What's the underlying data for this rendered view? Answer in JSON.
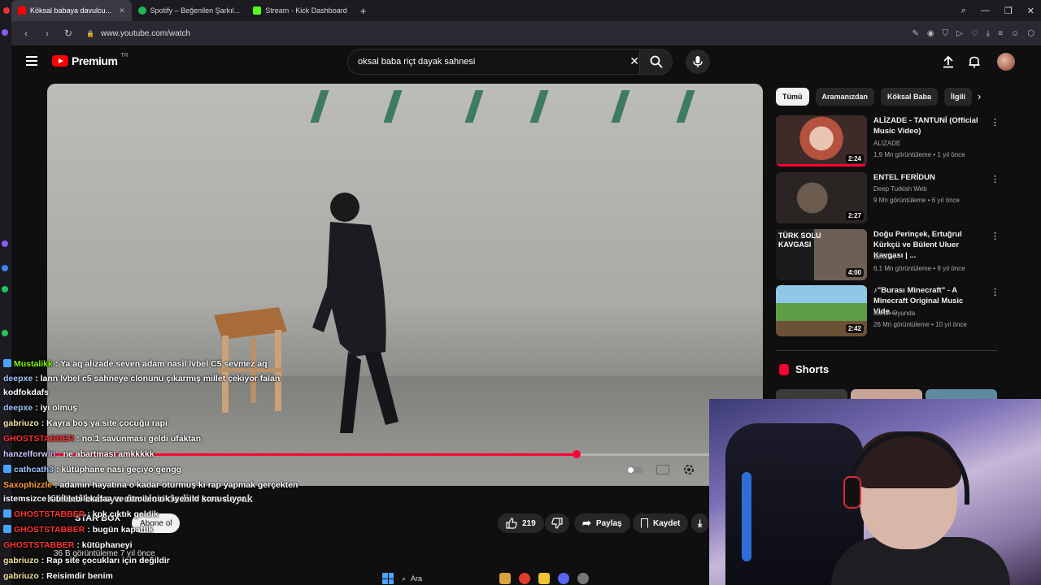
{
  "browser": {
    "tabs": [
      {
        "label": "Köksal babaya davulcu...",
        "color": "#ff0000",
        "active": true
      },
      {
        "label": "Spotify – Beğenilen Şarkıl...",
        "color": "#1db954",
        "active": false
      },
      {
        "label": "Stream - Kick Dashboard",
        "color": "#53fc18",
        "active": false
      }
    ],
    "new_tab": "+",
    "url": "www.youtube.com/watch"
  },
  "youtube": {
    "logo": "Premium",
    "country": "TR",
    "search_value": "oksal baba riçt dayak sahnesi",
    "clear": "✕"
  },
  "video": {
    "progress_fraction": 0.74,
    "title": "Köksal babaya davulcu dedim sıra dayak",
    "channel": "STAR BOX",
    "subscribe": "Abone ol",
    "likes": "219",
    "share": "Paylaş",
    "save": "Kaydet",
    "views_meta": "36 B görüntüleme  7 yıl önce"
  },
  "sidebar": {
    "chips": [
      "Tümü",
      "Aramanızdan",
      "Köksal Baba",
      "İlgili"
    ],
    "chip_next": "›",
    "recs": [
      {
        "title": "ALİZADE - TANTUNİ (Official Music Video)",
        "channel": "ALİZADE",
        "views": "1,9 Mn görüntüleme • 1 yıl önce",
        "duration": "2:24",
        "thumb": "#d07b6b"
      },
      {
        "title": "ENTEL FERİDUN",
        "channel": "Deep Turkish Web",
        "views": "9 Mn görüntüleme • 6 yıl önce",
        "duration": "2:27",
        "thumb": "#4b4540"
      },
      {
        "title": "Doğu Perinçek, Ertuğrul Kürkçü ve Bülent Uluer Kavgası | ...",
        "channel": "32.Gün",
        "views": "6,1 Mn görüntüleme • 9 yıl önce",
        "duration": "4:00",
        "thumb": "#3a3430",
        "overlay": "TÜRK SOLU KAVGASI"
      },
      {
        "title": "♪\"Burası Minecraft\" - A Minecraft Original Music Vide...",
        "channel": "Burak Oyunda",
        "views": "26 Mn görüntüleme • 10 yıl önce",
        "duration": "2:42",
        "thumb": "#5f9d46"
      }
    ],
    "shorts": "Shorts"
  },
  "chat": [
    {
      "user": "Mustalikk",
      "color": "#7cfc00",
      "badge": true,
      "text": ": Ya aq alizade seven adam nasil lvbel C5 sevmez aq"
    },
    {
      "user": "deepxe",
      "color": "#9ec6ff",
      "badge": false,
      "text": ": lann lvbel c5 sahneye clonunu çıkarmış millet çekiyor falan"
    },
    {
      "user": "",
      "color": "#ffffff",
      "badge": false,
      "text": "kodfokdafs"
    },
    {
      "user": "deepxe",
      "color": "#9ec6ff",
      "badge": false,
      "text": ": iyi olmuş"
    },
    {
      "user": "gabriuzo",
      "color": "#f0e0a0",
      "badge": false,
      "text": ": Kayra boş ya site çocuğu rapi"
    },
    {
      "user": "GHOSTSTABBER",
      "color": "#ff3030",
      "badge": false,
      "text": ": no.1 savunması geldi ufaktan"
    },
    {
      "user": "hanzelforwin",
      "color": "#c9c9ff",
      "badge": false,
      "text": ": ne abartması amkkkkk"
    },
    {
      "user": "cathcath3",
      "color": "#9ec6ff",
      "badge": true,
      "text": ": kütüphane nasi geçiyo gengg"
    },
    {
      "user": "Saxophizzle",
      "color": "#ff9a3c",
      "badge": false,
      "text": ": adamın hayatına o kadar oturmuş ki rap yapmak gerçekten"
    },
    {
      "user": "",
      "color": "#ffffff",
      "badge": false,
      "text": "istemsizce sitelilebilekafaa ve ritmilenirik iyenild konusuyor"
    },
    {
      "user": "GHOSTSTABBER",
      "color": "#ff3030",
      "badge": true,
      "text": ": kpk çıktık geldik"
    },
    {
      "user": "GHOSTSTABBER",
      "color": "#ff3030",
      "badge": true,
      "text": ": bugün kapattık"
    },
    {
      "user": "GHOSTSTABBER",
      "color": "#ff3030",
      "badge": false,
      "text": ": kütüphaneyi"
    },
    {
      "user": "gabriuzo",
      "color": "#f0e0a0",
      "badge": false,
      "text": ": Rap site çocukları için değildir"
    },
    {
      "user": "gabriuzo",
      "color": "#f0e0a0",
      "badge": false,
      "text": ": Reisimdir benim"
    }
  ],
  "taskbar": {
    "search": "Ara"
  }
}
